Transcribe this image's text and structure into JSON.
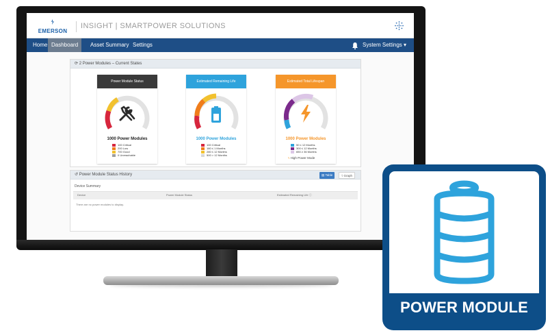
{
  "app": {
    "logo_text": "EMERSON",
    "title": "INSIGHT | SMARTPOWER SOLUTIONS"
  },
  "nav": {
    "items": [
      {
        "label": "Home",
        "active": false
      },
      {
        "label": "Dashboard",
        "active": true
      },
      {
        "label": "Asset Summary",
        "active": false
      },
      {
        "label": "Settings",
        "active": false
      }
    ],
    "system_settings": "System Settings ▾"
  },
  "states_panel": {
    "title": "2 Power Modules – Current States",
    "cards": [
      {
        "header": "Power Module Status",
        "header_color": "#3a3a3a",
        "icon": "tools-icon",
        "count": "1000 Power Modules",
        "count_color": "#222222",
        "legend": [
          {
            "color": "#d7263d",
            "text": "100 Critical"
          },
          {
            "color": "#f07d1b",
            "text": "200 Low"
          },
          {
            "color": "#f2c12e",
            "text": "700 Good"
          },
          {
            "color": "#9e9e9e",
            "text": "0 Unreachable"
          }
        ]
      },
      {
        "header": "Estimated Remaining Life",
        "header_color": "#2ea3dc",
        "icon": "battery-icon",
        "count": "1000 Power Modules",
        "count_color": "#2ea3dc",
        "legend": [
          {
            "color": "#d7263d",
            "text": "100   Critical"
          },
          {
            "color": "#f07d1b",
            "text": "180   ≤ 1 Months"
          },
          {
            "color": "#f2c12e",
            "text": "280   ≤ 12 Months"
          },
          {
            "color": "#d8d8d8",
            "text": "500   > 12 Months"
          }
        ]
      },
      {
        "header": "Estimated Total Lifespan",
        "header_color": "#f5962b",
        "icon": "lightning-icon",
        "count": "1000 Power Modules",
        "count_color": "#f5962b",
        "legend": [
          {
            "color": "#2ea3dc",
            "text": "50 ≤ 12 Months"
          },
          {
            "color": "#7b2a8c",
            "text": "300 ≤ 12 Months"
          },
          {
            "color": "#dcc6e6",
            "text": "650 ≥ 36 Months"
          }
        ],
        "high_power_mode": "High Power Mode"
      }
    ]
  },
  "history_panel": {
    "title": "Power Module Status History",
    "table_button": "Table",
    "graph_button": "Graph",
    "sub_heading": "Device Summary",
    "columns": [
      "Device",
      "Power Module Status",
      "Estimated Remaining Life"
    ],
    "empty_text": "There are no power modules to display."
  },
  "tile": {
    "icon": "battery-icon",
    "label": "POWER MODULE",
    "color": "#0d4e88",
    "icon_color": "#2ea3dc"
  }
}
